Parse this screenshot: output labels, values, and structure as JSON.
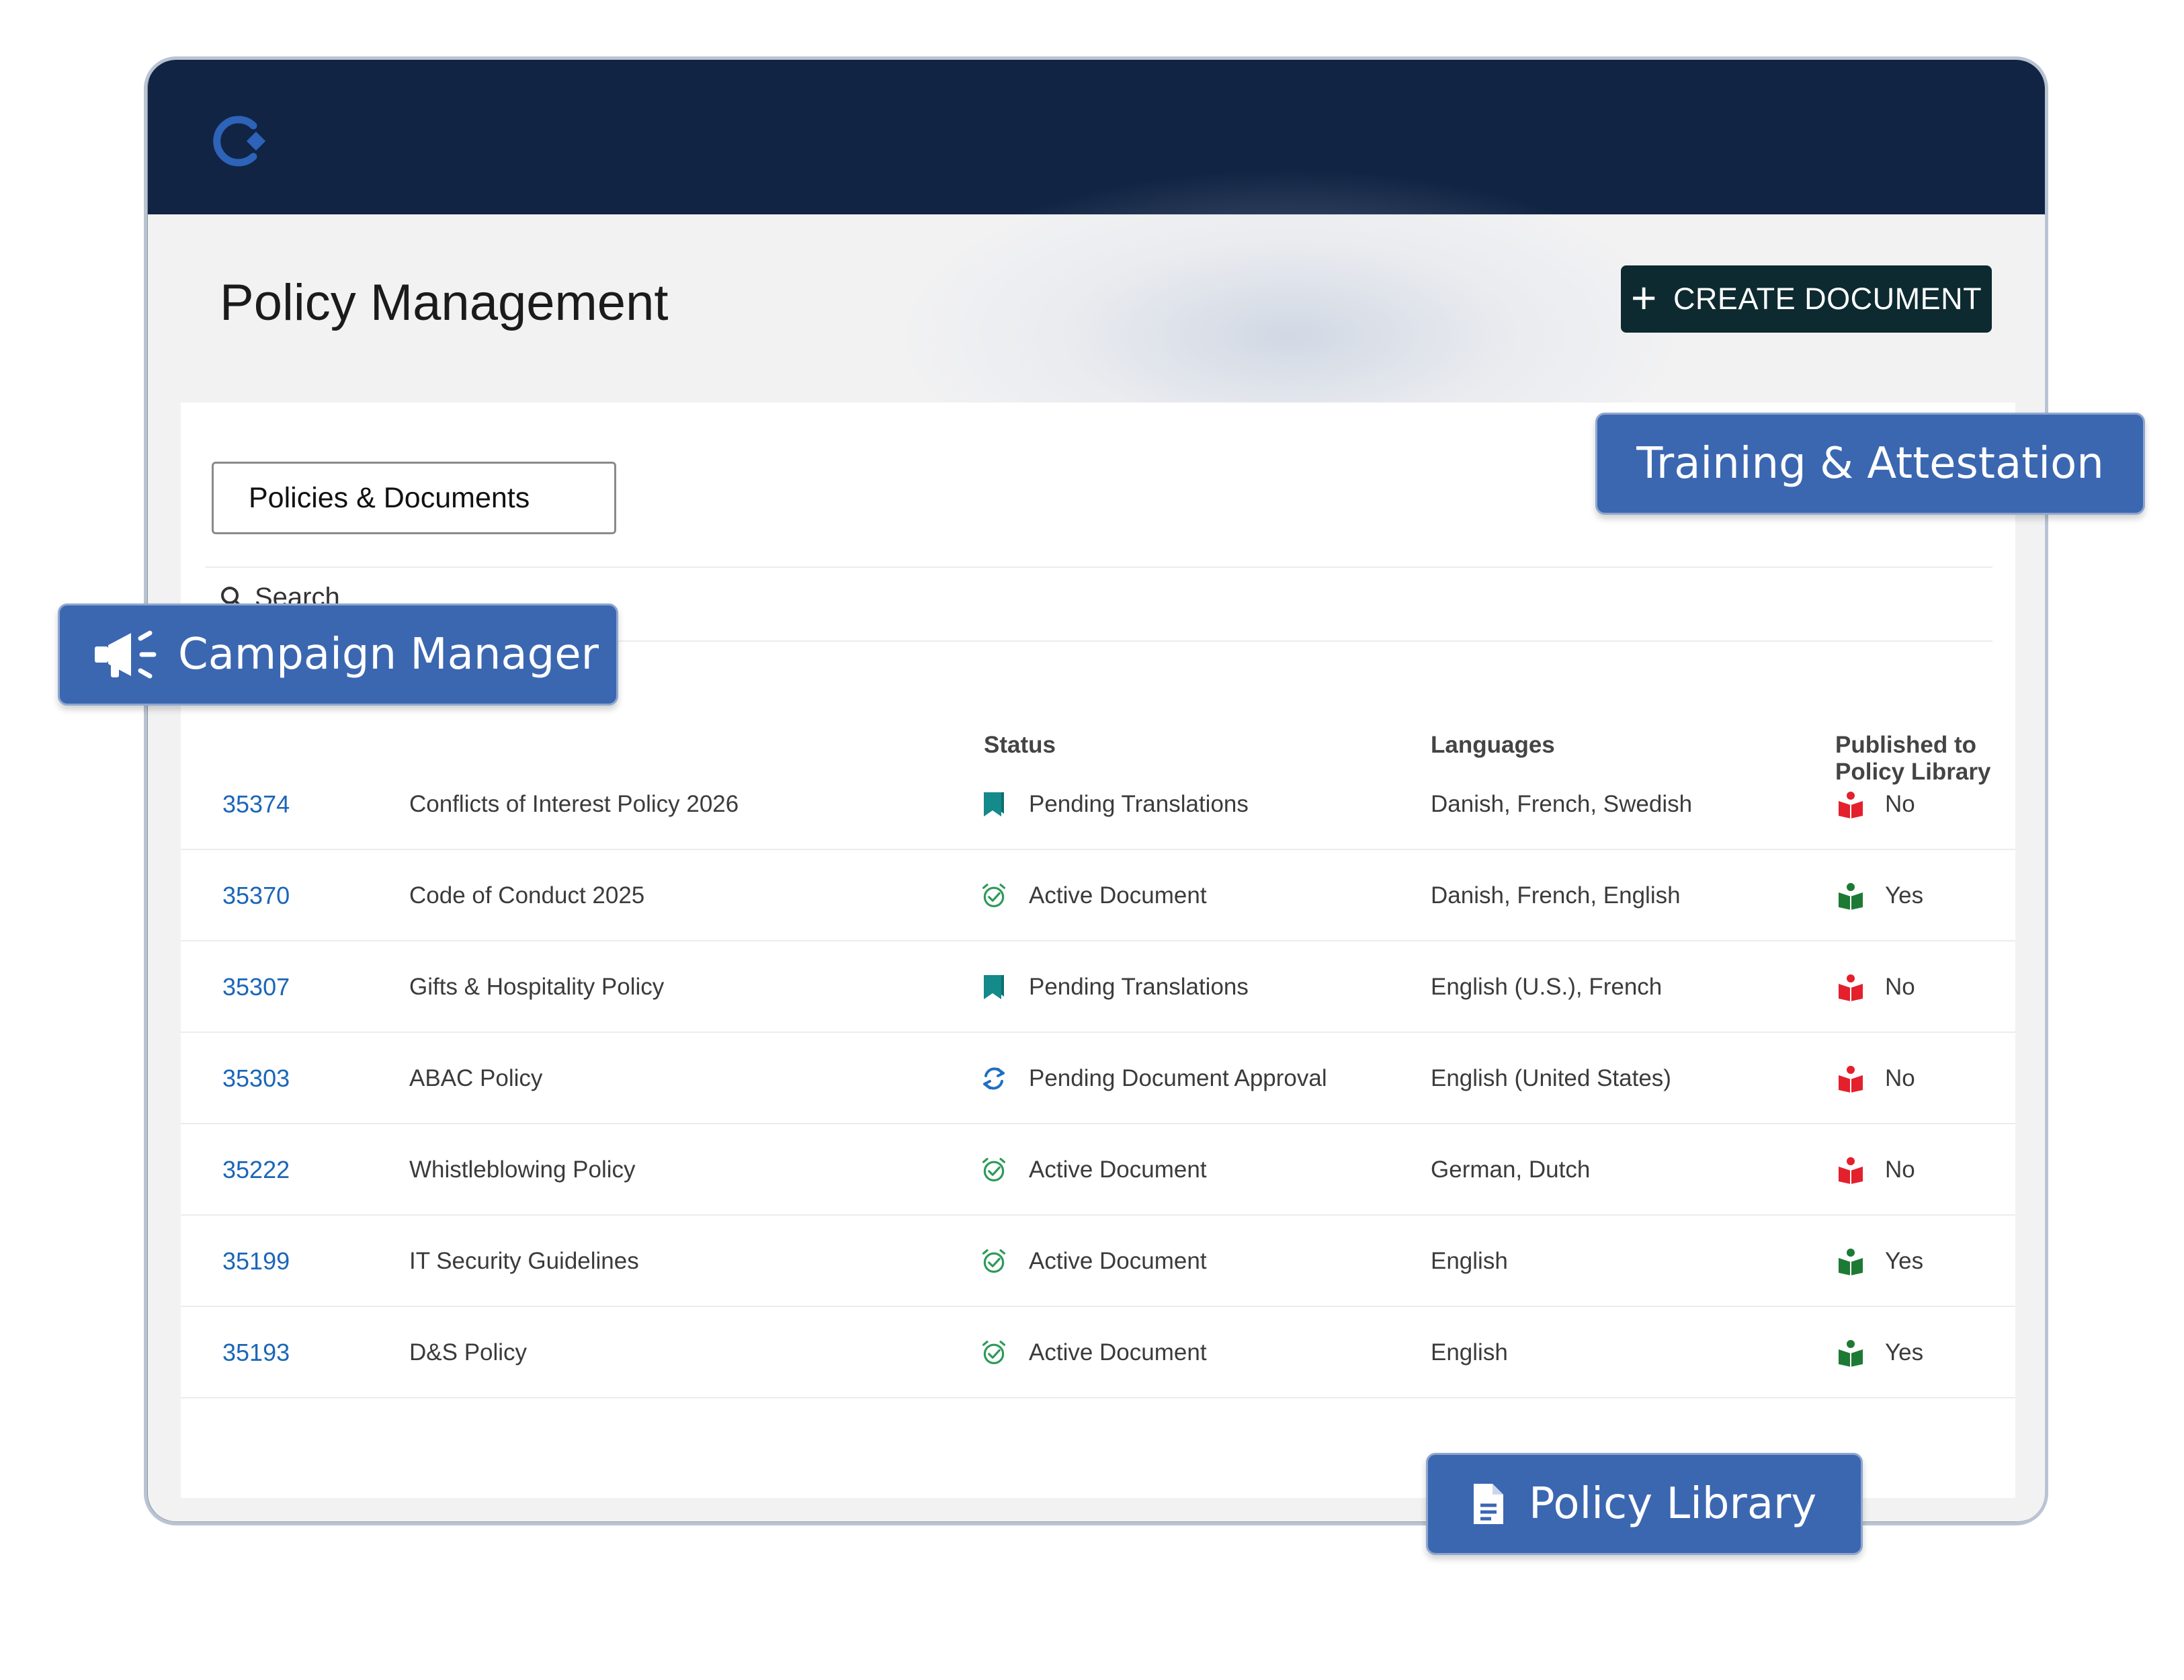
{
  "header": {
    "logo_icon": "brand-logo-icon",
    "page_title": "Policy Management",
    "create_button_label": "CREATE DOCUMENT",
    "create_button_icon": "plus-icon"
  },
  "tabs": [
    {
      "label": "Policies & Documents"
    }
  ],
  "search": {
    "label": "Search",
    "icon": "search-icon"
  },
  "table": {
    "headers": {
      "status": "Status",
      "languages": "Languages",
      "published": "Published to Policy Library"
    },
    "rows": [
      {
        "id": "35374",
        "name": "Conflicts of Interest Policy 2026",
        "status": "Pending Translations",
        "status_icon": "bookmark-icon",
        "languages": "Danish, French, Swedish",
        "published": "No"
      },
      {
        "id": "35370",
        "name": "Code of Conduct 2025",
        "status": "Active Document",
        "status_icon": "alarm-check-icon",
        "languages": "Danish, French, English",
        "published": "Yes"
      },
      {
        "id": "35307",
        "name": "Gifts & Hospitality Policy",
        "status": "Pending Translations",
        "status_icon": "bookmark-icon",
        "languages": "English (U.S.), French",
        "published": "No"
      },
      {
        "id": "35303",
        "name": "ABAC Policy",
        "status": "Pending Document Approval",
        "status_icon": "sync-icon",
        "languages": "English (United States)",
        "published": "No"
      },
      {
        "id": "35222",
        "name": "Whistleblowing Policy",
        "status": "Active Document",
        "status_icon": "alarm-check-icon",
        "languages": "German, Dutch",
        "published": "No"
      },
      {
        "id": "35199",
        "name": "IT Security Guidelines",
        "status": "Active Document",
        "status_icon": "alarm-check-icon",
        "languages": "English",
        "published": "Yes"
      },
      {
        "id": "35193",
        "name": "D&S Policy",
        "status": "Active Document",
        "status_icon": "alarm-check-icon",
        "languages": "English",
        "published": "Yes"
      }
    ]
  },
  "badges": {
    "training": "Training & Attestation",
    "campaign": "Campaign Manager",
    "library": "Policy Library"
  },
  "colors": {
    "topbar": "#112443",
    "create_button": "#0d2a30",
    "badge": "#3b67b1",
    "link": "#1a66b8",
    "published_yes": "#1d7a34",
    "published_no": "#e4202c",
    "status_teal": "#148a8a",
    "status_green": "#2e9a58",
    "status_blue": "#1f6fc1"
  }
}
